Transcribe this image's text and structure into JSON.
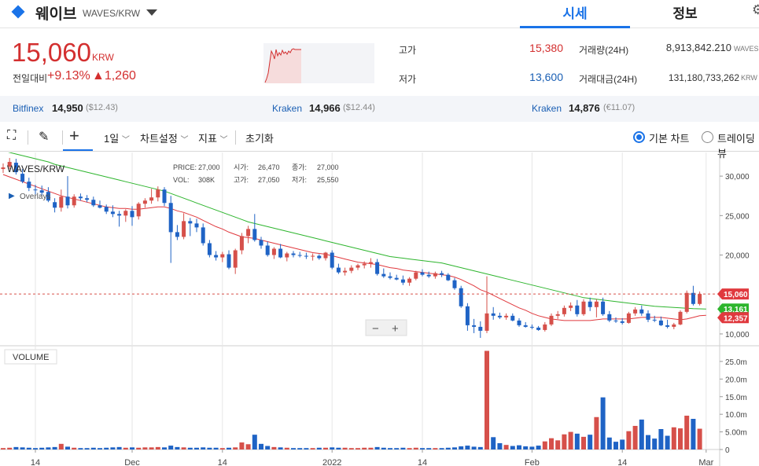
{
  "header": {
    "coin_name": "웨이브",
    "pair": "WAVES/KRW",
    "tabs": [
      {
        "label": "시세",
        "active": true
      },
      {
        "label": "정보",
        "active": false
      }
    ],
    "accent_color": "#1a73e8"
  },
  "price": {
    "current": "15,060",
    "unit": "KRW",
    "change_label": "전일대비",
    "change_pct": "+9.13%",
    "change_abs": "▲1,260",
    "up_color": "#d32f2f"
  },
  "stats": {
    "high_label": "고가",
    "high": "15,380",
    "low_label": "저가",
    "low": "13,600",
    "volume_label": "거래량(24H)",
    "volume": "8,913,842.210",
    "volume_unit": "WAVES",
    "amount_label": "거래대금(24H)",
    "amount": "131,180,733,262",
    "amount_unit": "KRW"
  },
  "exchanges": [
    {
      "name": "Bitfinex",
      "price": "14,950",
      "sub": "($12.43)"
    },
    {
      "name": "Kraken",
      "price": "14,966",
      "sub": "($12.44)"
    },
    {
      "name": "Kraken",
      "price": "14,876",
      "sub": "(€11.07)"
    }
  ],
  "toolbar": {
    "interval": "1일",
    "chart_settings": "차트설정",
    "indicators": "지표",
    "reset": "초기화",
    "basic_chart": "기본 차트",
    "trading_chart": "트레이딩뷰"
  },
  "chart_info": {
    "symbol": "WAVES/KRW",
    "overlays": "Overlays",
    "price_label": "PRICE:",
    "price": "27,000",
    "open_label": "시가:",
    "open": "26,470",
    "close_label": "종가:",
    "close": "27,000",
    "vol_label": "VOL:",
    "vol": "308K",
    "high_label": "고가:",
    "high": "27,050",
    "low_label": "저가:",
    "low": "25,550",
    "volume_panel": "VOLUME",
    "last_price_tag": "15,060",
    "ma_long_tag": "13,161",
    "ma_short_tag": "12,357",
    "zoom_out": "−",
    "zoom_in": "+"
  },
  "chart_data": {
    "type": "candlestick",
    "y_ticks": [
      "30,000",
      "25,000",
      "20,000",
      "15,000",
      "10,000"
    ],
    "y_tick_values": [
      30000,
      25000,
      20000,
      15000,
      10000
    ],
    "volume_ticks": [
      "25.0m",
      "20.0m",
      "15.0m",
      "10.0m",
      "5.00m",
      "0"
    ],
    "volume_tick_values": [
      25,
      20,
      15,
      10,
      5,
      0
    ],
    "x_ticks": [
      "14",
      "Dec",
      "14",
      "2022",
      "14",
      "Feb",
      "14",
      "Mar"
    ],
    "x_tick_index": [
      5,
      20,
      34,
      51,
      65,
      82,
      96,
      109
    ],
    "ylim": [
      8500,
      33000
    ],
    "volume_ylim": [
      0,
      29
    ],
    "up_color": "#d6504a",
    "down_color": "#1f63c5",
    "ma_short_color": "#e0393e",
    "ma_long_color": "#2db52d",
    "candles": [
      {
        "o": 30900,
        "h": 31600,
        "l": 30400,
        "c": 31100,
        "v": 0.4
      },
      {
        "o": 31200,
        "h": 32300,
        "l": 30900,
        "c": 31800,
        "v": 0.5
      },
      {
        "o": 31700,
        "h": 32200,
        "l": 30200,
        "c": 30500,
        "v": 0.7
      },
      {
        "o": 30300,
        "h": 30900,
        "l": 29100,
        "c": 29300,
        "v": 0.6
      },
      {
        "o": 29300,
        "h": 29800,
        "l": 28100,
        "c": 28500,
        "v": 0.5
      },
      {
        "o": 28300,
        "h": 28900,
        "l": 27700,
        "c": 28200,
        "v": 0.4
      },
      {
        "o": 28200,
        "h": 28800,
        "l": 27500,
        "c": 27900,
        "v": 0.5
      },
      {
        "o": 28000,
        "h": 28600,
        "l": 26700,
        "c": 26900,
        "v": 0.6
      },
      {
        "o": 26700,
        "h": 27200,
        "l": 25400,
        "c": 26000,
        "v": 0.7
      },
      {
        "o": 26000,
        "h": 28300,
        "l": 25500,
        "c": 27400,
        "v": 1.6
      },
      {
        "o": 27400,
        "h": 30000,
        "l": 25900,
        "c": 26300,
        "v": 0.8
      },
      {
        "o": 26300,
        "h": 27700,
        "l": 26000,
        "c": 27400,
        "v": 0.5
      },
      {
        "o": 27400,
        "h": 27800,
        "l": 26900,
        "c": 27200,
        "v": 0.4
      },
      {
        "o": 27200,
        "h": 27600,
        "l": 26700,
        "c": 27000,
        "v": 0.4
      },
      {
        "o": 27000,
        "h": 27400,
        "l": 26100,
        "c": 26300,
        "v": 0.5
      },
      {
        "o": 26300,
        "h": 26900,
        "l": 25900,
        "c": 26000,
        "v": 0.4
      },
      {
        "o": 26100,
        "h": 26400,
        "l": 25200,
        "c": 25500,
        "v": 0.5
      },
      {
        "o": 25500,
        "h": 26300,
        "l": 24800,
        "c": 25200,
        "v": 0.6
      },
      {
        "o": 25200,
        "h": 25600,
        "l": 23600,
        "c": 25000,
        "v": 0.7
      },
      {
        "o": 25000,
        "h": 25800,
        "l": 24200,
        "c": 25600,
        "v": 0.5
      },
      {
        "o": 25600,
        "h": 26200,
        "l": 23700,
        "c": 24800,
        "v": 0.6
      },
      {
        "o": 24900,
        "h": 26700,
        "l": 24500,
        "c": 26500,
        "v": 0.5
      },
      {
        "o": 26500,
        "h": 27200,
        "l": 26000,
        "c": 26900,
        "v": 0.6
      },
      {
        "o": 26900,
        "h": 28400,
        "l": 26500,
        "c": 27300,
        "v": 0.6
      },
      {
        "o": 27300,
        "h": 28700,
        "l": 26800,
        "c": 28300,
        "v": 0.7
      },
      {
        "o": 28300,
        "h": 28600,
        "l": 26200,
        "c": 26600,
        "v": 0.6
      },
      {
        "o": 26600,
        "h": 27500,
        "l": 19000,
        "c": 22900,
        "v": 1.1
      },
      {
        "o": 22900,
        "h": 23800,
        "l": 21900,
        "c": 22300,
        "v": 0.7
      },
      {
        "o": 22300,
        "h": 25300,
        "l": 22000,
        "c": 24300,
        "v": 0.6
      },
      {
        "o": 24300,
        "h": 24700,
        "l": 22400,
        "c": 24000,
        "v": 0.5
      },
      {
        "o": 24000,
        "h": 24600,
        "l": 22900,
        "c": 23500,
        "v": 0.5
      },
      {
        "o": 23500,
        "h": 24000,
        "l": 21200,
        "c": 21500,
        "v": 0.6
      },
      {
        "o": 21500,
        "h": 21900,
        "l": 19700,
        "c": 20000,
        "v": 0.5
      },
      {
        "o": 20000,
        "h": 20500,
        "l": 19300,
        "c": 19700,
        "v": 0.5
      },
      {
        "o": 19700,
        "h": 20400,
        "l": 19100,
        "c": 20100,
        "v": 0.4
      },
      {
        "o": 20100,
        "h": 20600,
        "l": 18200,
        "c": 18400,
        "v": 0.5
      },
      {
        "o": 18400,
        "h": 20800,
        "l": 17600,
        "c": 20600,
        "v": 0.6
      },
      {
        "o": 20600,
        "h": 22800,
        "l": 20100,
        "c": 22400,
        "v": 2.0
      },
      {
        "o": 22400,
        "h": 23700,
        "l": 21500,
        "c": 23300,
        "v": 1.5
      },
      {
        "o": 23300,
        "h": 25200,
        "l": 21700,
        "c": 21900,
        "v": 4.2
      },
      {
        "o": 21900,
        "h": 22300,
        "l": 20800,
        "c": 21200,
        "v": 1.6
      },
      {
        "o": 21200,
        "h": 21700,
        "l": 19800,
        "c": 20000,
        "v": 1.0
      },
      {
        "o": 20000,
        "h": 21000,
        "l": 19500,
        "c": 20800,
        "v": 0.7
      },
      {
        "o": 20800,
        "h": 21400,
        "l": 19600,
        "c": 19700,
        "v": 0.6
      },
      {
        "o": 19700,
        "h": 20400,
        "l": 19200,
        "c": 20200,
        "v": 0.5
      },
      {
        "o": 20200,
        "h": 20500,
        "l": 19700,
        "c": 20000,
        "v": 0.4
      },
      {
        "o": 20000,
        "h": 20400,
        "l": 19700,
        "c": 19900,
        "v": 0.4
      },
      {
        "o": 19900,
        "h": 20300,
        "l": 19500,
        "c": 19800,
        "v": 0.4
      },
      {
        "o": 19800,
        "h": 20200,
        "l": 19300,
        "c": 19900,
        "v": 0.4
      },
      {
        "o": 19900,
        "h": 20100,
        "l": 19400,
        "c": 19600,
        "v": 0.5
      },
      {
        "o": 19600,
        "h": 20400,
        "l": 19300,
        "c": 20300,
        "v": 0.5
      },
      {
        "o": 20300,
        "h": 20600,
        "l": 18200,
        "c": 18400,
        "v": 0.6
      },
      {
        "o": 18400,
        "h": 18900,
        "l": 17600,
        "c": 17800,
        "v": 0.5
      },
      {
        "o": 17800,
        "h": 18400,
        "l": 17400,
        "c": 18000,
        "v": 0.5
      },
      {
        "o": 18000,
        "h": 18700,
        "l": 17700,
        "c": 18400,
        "v": 0.4
      },
      {
        "o": 18400,
        "h": 18900,
        "l": 18100,
        "c": 18700,
        "v": 0.4
      },
      {
        "o": 18700,
        "h": 19200,
        "l": 18300,
        "c": 18900,
        "v": 0.5
      },
      {
        "o": 18900,
        "h": 19600,
        "l": 18400,
        "c": 19100,
        "v": 0.5
      },
      {
        "o": 19100,
        "h": 19500,
        "l": 17400,
        "c": 17600,
        "v": 0.7
      },
      {
        "o": 17600,
        "h": 18300,
        "l": 17100,
        "c": 17300,
        "v": 0.5
      },
      {
        "o": 17300,
        "h": 17800,
        "l": 16900,
        "c": 17100,
        "v": 0.4
      },
      {
        "o": 17100,
        "h": 17500,
        "l": 16800,
        "c": 16900,
        "v": 0.4
      },
      {
        "o": 16900,
        "h": 17400,
        "l": 16200,
        "c": 16500,
        "v": 0.5
      },
      {
        "o": 16500,
        "h": 17200,
        "l": 16100,
        "c": 17000,
        "v": 0.4
      },
      {
        "o": 17000,
        "h": 18000,
        "l": 16800,
        "c": 17800,
        "v": 0.5
      },
      {
        "o": 17800,
        "h": 18200,
        "l": 17300,
        "c": 17500,
        "v": 0.4
      },
      {
        "o": 17500,
        "h": 17900,
        "l": 17100,
        "c": 17300,
        "v": 0.4
      },
      {
        "o": 17300,
        "h": 17900,
        "l": 17000,
        "c": 17700,
        "v": 0.4
      },
      {
        "o": 17700,
        "h": 18000,
        "l": 17200,
        "c": 17500,
        "v": 0.4
      },
      {
        "o": 17500,
        "h": 17700,
        "l": 16700,
        "c": 16800,
        "v": 0.5
      },
      {
        "o": 16800,
        "h": 17100,
        "l": 15600,
        "c": 15800,
        "v": 0.6
      },
      {
        "o": 15800,
        "h": 16100,
        "l": 13300,
        "c": 13500,
        "v": 0.9
      },
      {
        "o": 13500,
        "h": 13900,
        "l": 10400,
        "c": 11100,
        "v": 1.1
      },
      {
        "o": 11100,
        "h": 11900,
        "l": 10100,
        "c": 10900,
        "v": 0.8
      },
      {
        "o": 10900,
        "h": 11600,
        "l": 9500,
        "c": 10400,
        "v": 0.7
      },
      {
        "o": 10400,
        "h": 17300,
        "l": 10100,
        "c": 12600,
        "v": 28.0
      },
      {
        "o": 12600,
        "h": 13400,
        "l": 11800,
        "c": 12300,
        "v": 3.5
      },
      {
        "o": 12300,
        "h": 12700,
        "l": 11900,
        "c": 12100,
        "v": 1.8
      },
      {
        "o": 12100,
        "h": 12600,
        "l": 11800,
        "c": 12300,
        "v": 1.3
      },
      {
        "o": 12300,
        "h": 12600,
        "l": 11600,
        "c": 11700,
        "v": 1.0
      },
      {
        "o": 11700,
        "h": 12000,
        "l": 10900,
        "c": 11100,
        "v": 1.2
      },
      {
        "o": 11100,
        "h": 11500,
        "l": 10800,
        "c": 10900,
        "v": 0.9
      },
      {
        "o": 10900,
        "h": 11200,
        "l": 10600,
        "c": 10800,
        "v": 0.8
      },
      {
        "o": 10800,
        "h": 11000,
        "l": 10400,
        "c": 10500,
        "v": 1.1
      },
      {
        "o": 10500,
        "h": 11500,
        "l": 10300,
        "c": 11200,
        "v": 2.3
      },
      {
        "o": 11200,
        "h": 12600,
        "l": 11000,
        "c": 12300,
        "v": 3.2
      },
      {
        "o": 12300,
        "h": 12900,
        "l": 11900,
        "c": 12500,
        "v": 2.6
      },
      {
        "o": 12500,
        "h": 13600,
        "l": 12200,
        "c": 13300,
        "v": 4.3
      },
      {
        "o": 13300,
        "h": 14000,
        "l": 12900,
        "c": 13600,
        "v": 5.0
      },
      {
        "o": 13600,
        "h": 14300,
        "l": 12200,
        "c": 12500,
        "v": 4.5
      },
      {
        "o": 12500,
        "h": 14400,
        "l": 12300,
        "c": 14100,
        "v": 3.6
      },
      {
        "o": 14100,
        "h": 14600,
        "l": 12900,
        "c": 13400,
        "v": 4.2
      },
      {
        "o": 13400,
        "h": 14400,
        "l": 12100,
        "c": 14100,
        "v": 9.2
      },
      {
        "o": 14100,
        "h": 14600,
        "l": 12300,
        "c": 12500,
        "v": 14.8
      },
      {
        "o": 12500,
        "h": 12900,
        "l": 11500,
        "c": 11700,
        "v": 3.4
      },
      {
        "o": 11700,
        "h": 12100,
        "l": 11400,
        "c": 11600,
        "v": 2.2
      },
      {
        "o": 11600,
        "h": 12000,
        "l": 11200,
        "c": 11400,
        "v": 2.8
      },
      {
        "o": 11400,
        "h": 12800,
        "l": 11300,
        "c": 12600,
        "v": 5.2
      },
      {
        "o": 12600,
        "h": 13400,
        "l": 12300,
        "c": 13100,
        "v": 6.7
      },
      {
        "o": 13100,
        "h": 13600,
        "l": 12300,
        "c": 12600,
        "v": 8.5
      },
      {
        "o": 12600,
        "h": 13000,
        "l": 11500,
        "c": 11800,
        "v": 4.1
      },
      {
        "o": 11800,
        "h": 12300,
        "l": 11500,
        "c": 11700,
        "v": 3.1
      },
      {
        "o": 11700,
        "h": 12200,
        "l": 11000,
        "c": 11100,
        "v": 5.8
      },
      {
        "o": 11100,
        "h": 11800,
        "l": 10700,
        "c": 10900,
        "v": 3.9
      },
      {
        "o": 10900,
        "h": 11400,
        "l": 10600,
        "c": 11200,
        "v": 6.3
      },
      {
        "o": 11200,
        "h": 13000,
        "l": 11100,
        "c": 12800,
        "v": 6.0
      },
      {
        "o": 12800,
        "h": 15500,
        "l": 12600,
        "c": 15200,
        "v": 9.6
      },
      {
        "o": 15200,
        "h": 16100,
        "l": 13600,
        "c": 13800,
        "v": 8.7
      },
      {
        "o": 13800,
        "h": 15380,
        "l": 13600,
        "c": 15060,
        "v": 5.9
      }
    ],
    "ma_short": [
      30200,
      29900,
      29600,
      29300,
      29000,
      28700,
      28400,
      28100,
      27800,
      27500,
      27300,
      27100,
      26900,
      26700,
      26500,
      26300,
      26100,
      26000,
      25900,
      25900,
      25800,
      25800,
      25900,
      26000,
      26100,
      26100,
      25900,
      25600,
      25400,
      25100,
      24800,
      24400,
      24000,
      23600,
      23300,
      22900,
      22600,
      22300,
      22200,
      22100,
      21900,
      21700,
      21500,
      21300,
      21100,
      20900,
      20700,
      20500,
      20300,
      20200,
      20100,
      19900,
      19700,
      19500,
      19300,
      19100,
      19000,
      18900,
      18800,
      18600,
      18400,
      18300,
      18100,
      18000,
      17900,
      17800,
      17700,
      17600,
      17500,
      17400,
      17200,
      16900,
      16500,
      16100,
      15600,
      15300,
      14900,
      14500,
      14100,
      13700,
      13300,
      13000,
      12600,
      12300,
      12100,
      11900,
      11800,
      11700,
      11700,
      11700,
      11700,
      11700,
      11800,
      11900,
      11900,
      11900,
      11900,
      11900,
      12000,
      12100,
      12100,
      12100,
      12100,
      12000,
      11900,
      11800,
      11900,
      12100,
      12300,
      12357
    ],
    "ma_long": [
      33200,
      33000,
      32800,
      32600,
      32400,
      32200,
      32000,
      31800,
      31500,
      31300,
      31100,
      30900,
      30700,
      30500,
      30300,
      30100,
      29900,
      29700,
      29500,
      29300,
      29100,
      28900,
      28700,
      28500,
      28300,
      28100,
      27800,
      27500,
      27200,
      26900,
      26600,
      26300,
      26000,
      25700,
      25400,
      25100,
      24800,
      24500,
      24200,
      24000,
      23800,
      23600,
      23400,
      23200,
      23000,
      22800,
      22600,
      22400,
      22200,
      22000,
      21800,
      21600,
      21400,
      21200,
      21000,
      20800,
      20600,
      20400,
      20200,
      20000,
      19800,
      19700,
      19600,
      19500,
      19400,
      19300,
      19200,
      19100,
      19000,
      18800,
      18600,
      18400,
      18200,
      18000,
      17800,
      17600,
      17400,
      17200,
      17000,
      16800,
      16600,
      16400,
      16200,
      16000,
      15800,
      15600,
      15400,
      15200,
      15000,
      14800,
      14600,
      14500,
      14400,
      14300,
      14200,
      14100,
      14000,
      13900,
      13800,
      13700,
      13600,
      13500,
      13450,
      13400,
      13350,
      13300,
      13250,
      13200,
      13180,
      13161
    ]
  }
}
